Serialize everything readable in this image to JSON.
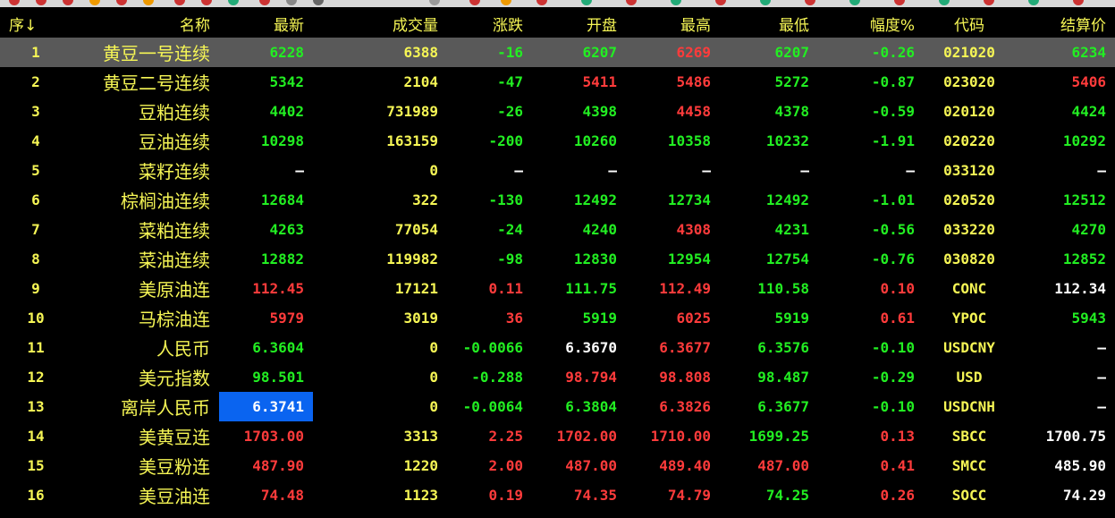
{
  "table": {
    "headers": {
      "idx": "序↓",
      "name": "名称",
      "last": "最新",
      "volume": "成交量",
      "change": "涨跌",
      "open": "开盘",
      "high": "最高",
      "low": "最低",
      "pct": "幅度%",
      "code": "代码",
      "settle": "结算价"
    },
    "rows": [
      {
        "idx": "1",
        "name": "黄豆一号连续",
        "last": "6228",
        "volume": "6388",
        "change": "-16",
        "open": "6207",
        "high": "6269",
        "low": "6207",
        "pct": "-0.26",
        "code": "021020",
        "settle": "6234"
      },
      {
        "idx": "2",
        "name": "黄豆二号连续",
        "last": "5342",
        "volume": "2104",
        "change": "-47",
        "open": "5411",
        "high": "5486",
        "low": "5272",
        "pct": "-0.87",
        "code": "023020",
        "settle": "5406"
      },
      {
        "idx": "3",
        "name": "豆粕连续",
        "last": "4402",
        "volume": "731989",
        "change": "-26",
        "open": "4398",
        "high": "4458",
        "low": "4378",
        "pct": "-0.59",
        "code": "020120",
        "settle": "4424"
      },
      {
        "idx": "4",
        "name": "豆油连续",
        "last": "10298",
        "volume": "163159",
        "change": "-200",
        "open": "10260",
        "high": "10358",
        "low": "10232",
        "pct": "-1.91",
        "code": "020220",
        "settle": "10292"
      },
      {
        "idx": "5",
        "name": "菜籽连续",
        "last": "—",
        "volume": "0",
        "change": "—",
        "open": "—",
        "high": "—",
        "low": "—",
        "pct": "—",
        "code": "033120",
        "settle": "—"
      },
      {
        "idx": "6",
        "name": "棕榈油连续",
        "last": "12684",
        "volume": "322",
        "change": "-130",
        "open": "12492",
        "high": "12734",
        "low": "12492",
        "pct": "-1.01",
        "code": "020520",
        "settle": "12512"
      },
      {
        "idx": "7",
        "name": "菜粕连续",
        "last": "4263",
        "volume": "77054",
        "change": "-24",
        "open": "4240",
        "high": "4308",
        "low": "4231",
        "pct": "-0.56",
        "code": "033220",
        "settle": "4270"
      },
      {
        "idx": "8",
        "name": "菜油连续",
        "last": "12882",
        "volume": "119982",
        "change": "-98",
        "open": "12830",
        "high": "12954",
        "low": "12754",
        "pct": "-0.76",
        "code": "030820",
        "settle": "12852"
      },
      {
        "idx": "9",
        "name": "美原油连",
        "last": "112.45",
        "volume": "17121",
        "change": "0.11",
        "open": "111.75",
        "high": "112.49",
        "low": "110.58",
        "pct": "0.10",
        "code": "CONC",
        "settle": "112.34"
      },
      {
        "idx": "10",
        "name": "马棕油连",
        "last": "5979",
        "volume": "3019",
        "change": "36",
        "open": "5919",
        "high": "6025",
        "low": "5919",
        "pct": "0.61",
        "code": "YPOC",
        "settle": "5943"
      },
      {
        "idx": "11",
        "name": "人民币",
        "last": "6.3604",
        "volume": "0",
        "change": "-0.0066",
        "open": "6.3670",
        "high": "6.3677",
        "low": "6.3576",
        "pct": "-0.10",
        "code": "USDCNY",
        "settle": "—"
      },
      {
        "idx": "12",
        "name": "美元指数",
        "last": "98.501",
        "volume": "0",
        "change": "-0.288",
        "open": "98.794",
        "high": "98.808",
        "low": "98.487",
        "pct": "-0.29",
        "code": "USD",
        "settle": "—"
      },
      {
        "idx": "13",
        "name": "离岸人民币",
        "last": "6.3741",
        "volume": "0",
        "change": "-0.0064",
        "open": "6.3804",
        "high": "6.3826",
        "low": "6.3677",
        "pct": "-0.10",
        "code": "USDCNH",
        "settle": "—"
      },
      {
        "idx": "14",
        "name": "美黄豆连",
        "last": "1703.00",
        "volume": "3313",
        "change": "2.25",
        "open": "1702.00",
        "high": "1710.00",
        "low": "1699.25",
        "pct": "0.13",
        "code": "SBCC",
        "settle": "1700.75"
      },
      {
        "idx": "15",
        "name": "美豆粉连",
        "last": "487.90",
        "volume": "1220",
        "change": "2.00",
        "open": "487.00",
        "high": "489.40",
        "low": "487.00",
        "pct": "0.41",
        "code": "SMCC",
        "settle": "485.90"
      },
      {
        "idx": "16",
        "name": "美豆油连",
        "last": "74.48",
        "volume": "1123",
        "change": "0.19",
        "open": "74.35",
        "high": "74.79",
        "low": "74.25",
        "pct": "0.26",
        "code": "SOCC",
        "settle": "74.29"
      }
    ],
    "colors": [
      {
        "last": "down",
        "change": "down",
        "open": "down",
        "high": "up",
        "low": "down",
        "pct": "down",
        "settle": "down"
      },
      {
        "last": "down",
        "change": "down",
        "open": "up",
        "high": "up",
        "low": "down",
        "pct": "down",
        "settle": "up"
      },
      {
        "last": "down",
        "change": "down",
        "open": "down",
        "high": "up",
        "low": "down",
        "pct": "down",
        "settle": "down"
      },
      {
        "last": "down",
        "change": "down",
        "open": "down",
        "high": "down",
        "low": "down",
        "pct": "down",
        "settle": "down"
      },
      {
        "last": "flat",
        "change": "flat",
        "open": "flat",
        "high": "flat",
        "low": "flat",
        "pct": "flat",
        "settle": "flat"
      },
      {
        "last": "down",
        "change": "down",
        "open": "down",
        "high": "down",
        "low": "down",
        "pct": "down",
        "settle": "down"
      },
      {
        "last": "down",
        "change": "down",
        "open": "down",
        "high": "up",
        "low": "down",
        "pct": "down",
        "settle": "down"
      },
      {
        "last": "down",
        "change": "down",
        "open": "down",
        "high": "down",
        "low": "down",
        "pct": "down",
        "settle": "down"
      },
      {
        "last": "up",
        "change": "up",
        "open": "down",
        "high": "up",
        "low": "down",
        "pct": "up",
        "settle": "flat"
      },
      {
        "last": "up",
        "change": "up",
        "open": "down",
        "high": "up",
        "low": "down",
        "pct": "up",
        "settle": "down"
      },
      {
        "last": "down",
        "change": "down",
        "open": "flat",
        "high": "up",
        "low": "down",
        "pct": "down",
        "settle": "flat"
      },
      {
        "last": "down",
        "change": "down",
        "open": "up",
        "high": "up",
        "low": "down",
        "pct": "down",
        "settle": "flat"
      },
      {
        "last": "flat",
        "change": "down",
        "open": "down",
        "high": "up",
        "low": "down",
        "pct": "down",
        "settle": "flat"
      },
      {
        "last": "up",
        "change": "up",
        "open": "up",
        "high": "up",
        "low": "down",
        "pct": "up",
        "settle": "flat"
      },
      {
        "last": "up",
        "change": "up",
        "open": "up",
        "high": "up",
        "low": "up",
        "pct": "up",
        "settle": "flat"
      },
      {
        "last": "up",
        "change": "up",
        "open": "up",
        "high": "up",
        "low": "down",
        "pct": "up",
        "settle": "flat"
      }
    ],
    "selected_row": 0,
    "highlight_cell": {
      "row": 12,
      "col": "last"
    }
  },
  "theme": {
    "background": "#000000",
    "header_color": "#f6f655",
    "up_color": "#ff3b3b",
    "down_color": "#22ee22",
    "flat_color": "#ffffff",
    "selection_color": "#595959",
    "cell_highlight_color": "#0a64f0"
  }
}
